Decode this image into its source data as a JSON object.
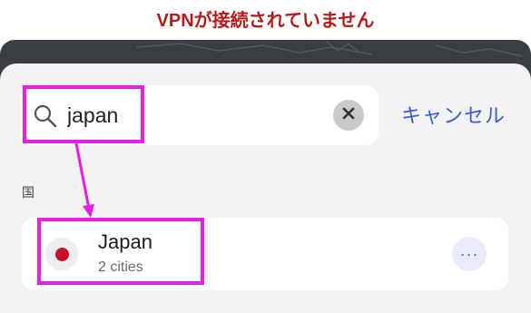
{
  "status": {
    "text": "VPNが接続されていません",
    "color": "#b31b1b"
  },
  "search": {
    "value": "japan",
    "icon": "search-icon",
    "clear_icon": "close-icon"
  },
  "cancel_label": "キャンセル",
  "section_label": "国",
  "results": [
    {
      "name": "Japan",
      "subtitle": "2 cities",
      "flag": "japan-flag-icon",
      "more_icon": "more-options-icon",
      "more_label": "···"
    }
  ],
  "colors": {
    "accent": "#3b5bd6",
    "highlight": "#e61ee6",
    "flag_red": "#c8102e"
  }
}
